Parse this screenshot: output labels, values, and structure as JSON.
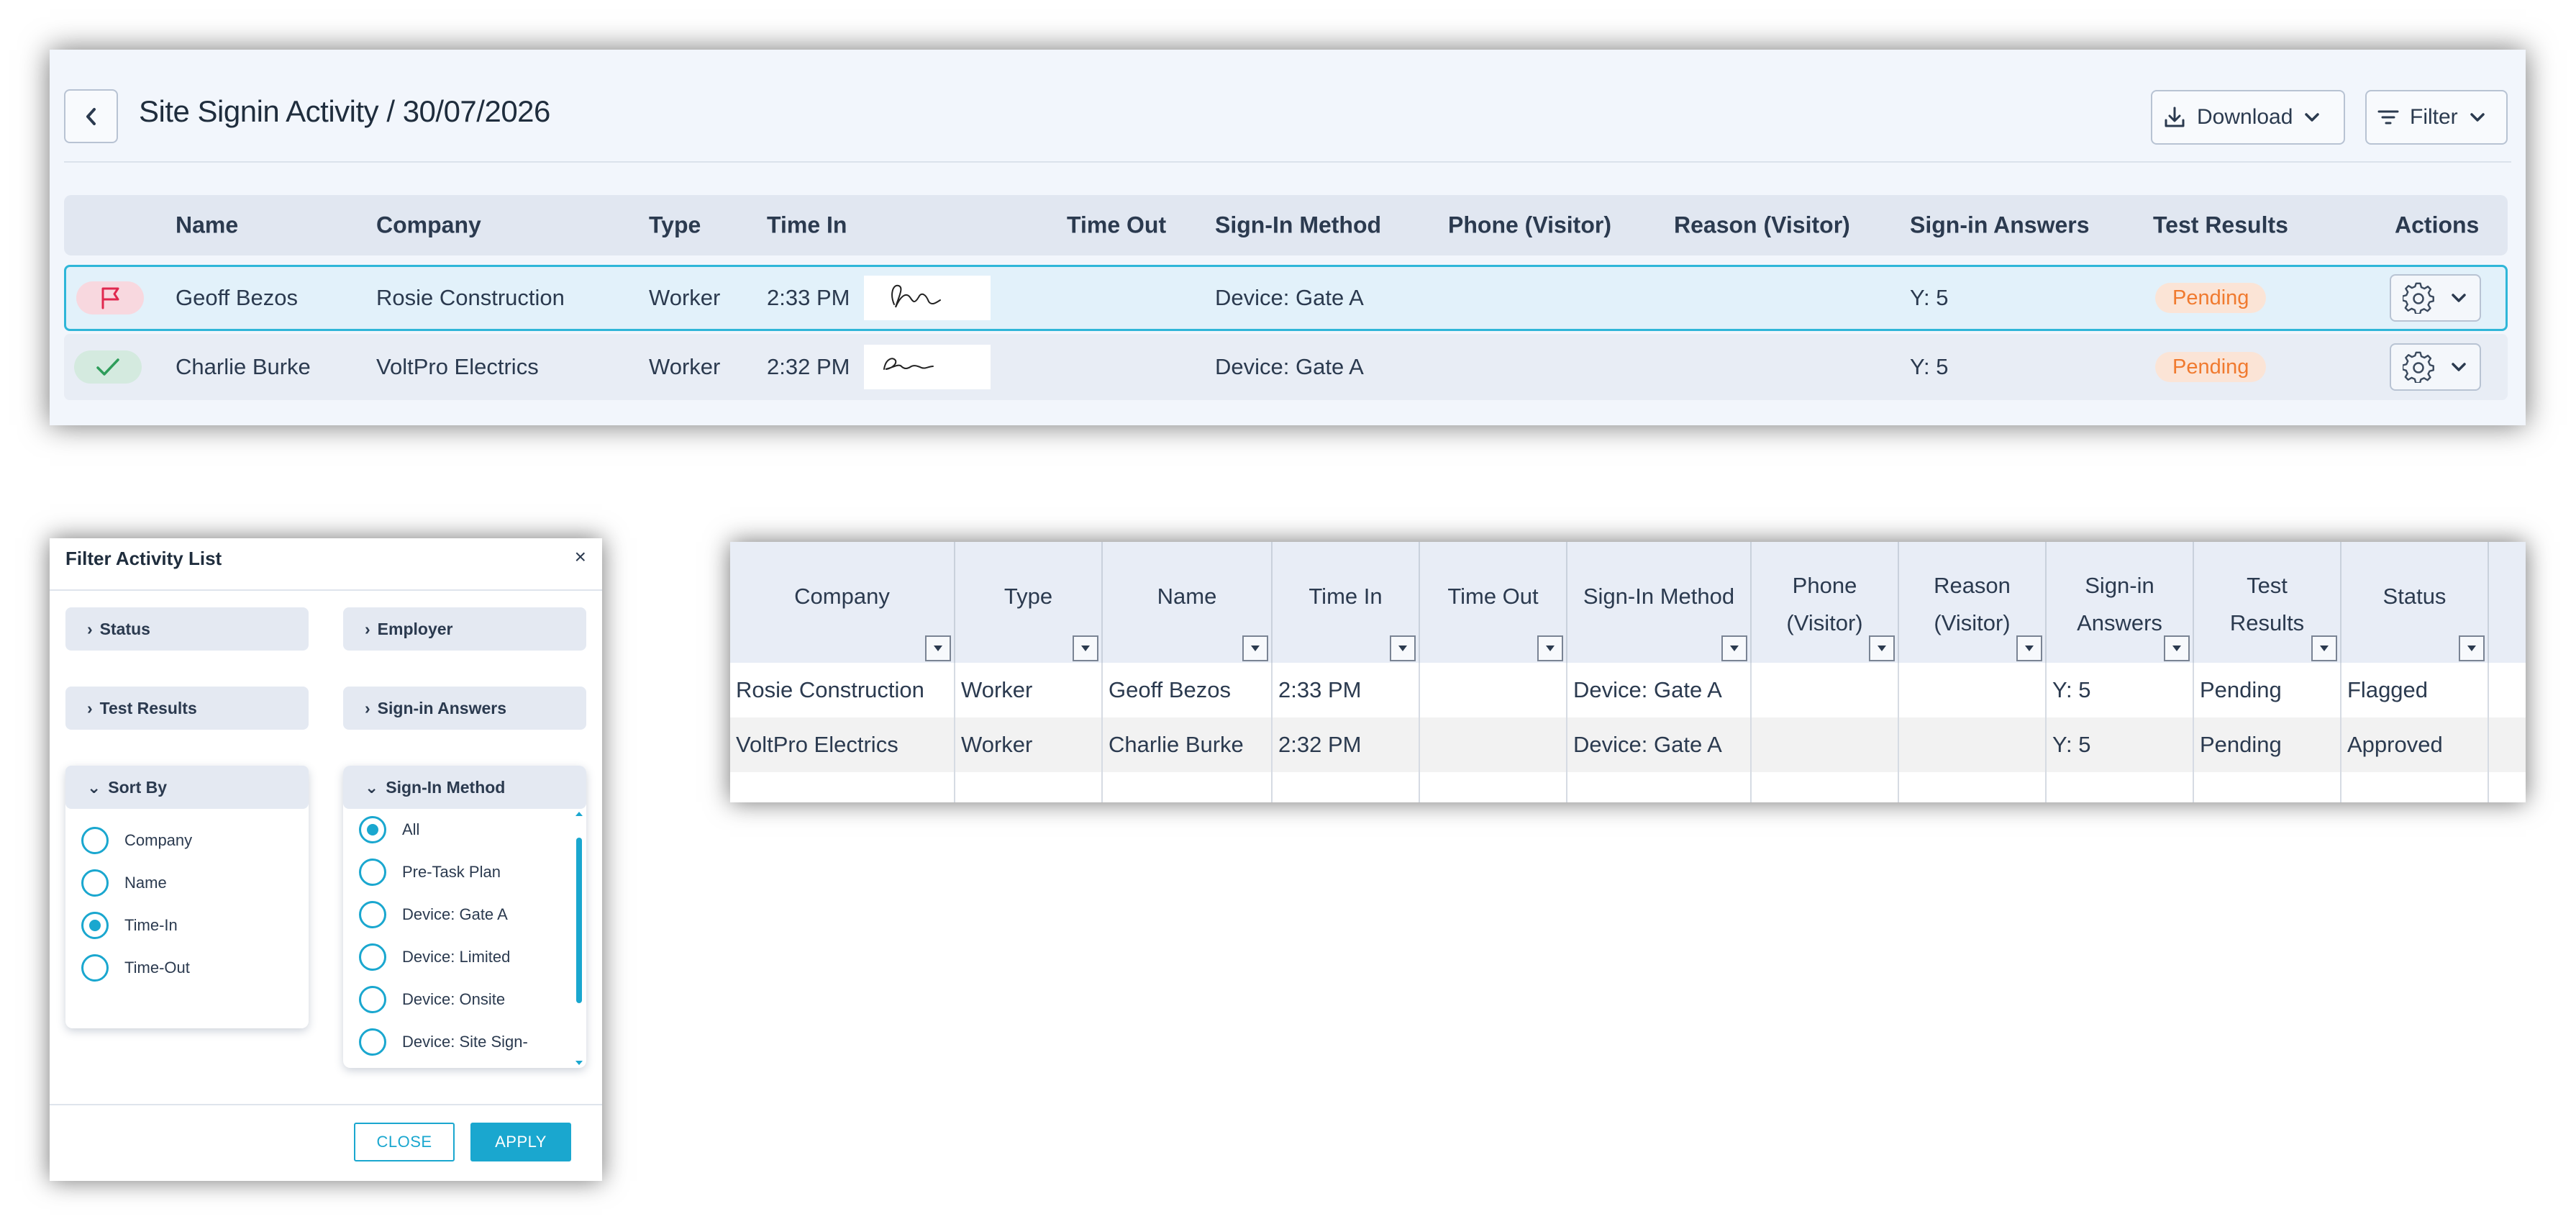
{
  "header": {
    "title": "Site Signin Activity",
    "separator": "/",
    "date": "30/07/2026",
    "download_label": "Download",
    "filter_label": "Filter"
  },
  "activity_table": {
    "columns": [
      "Name",
      "Company",
      "Type",
      "Time In",
      "Time Out",
      "Sign-In Method",
      "Phone (Visitor)",
      "Reason (Visitor)",
      "Sign-in Answers",
      "Test Results",
      "Actions"
    ],
    "rows": [
      {
        "status_icon": "flag-icon",
        "name": "Geoff Bezos",
        "company": "Rosie Construction",
        "type": "Worker",
        "time_in": "2:33 PM",
        "time_out": "",
        "method": "Device: Gate A",
        "answers": "Y: 5",
        "test_result": "Pending"
      },
      {
        "status_icon": "check-icon",
        "name": "Charlie Burke",
        "company": "VoltPro Electrics",
        "type": "Worker",
        "time_in": "2:32 PM",
        "time_out": "",
        "method": "Device: Gate A",
        "answers": "Y: 5",
        "test_result": "Pending"
      }
    ]
  },
  "filter_dialog": {
    "title": "Filter Activity List",
    "close_glyph": "×",
    "sections": {
      "status": "Status",
      "employer": "Employer",
      "test_results": "Test Results",
      "signin_answers": "Sign-in Answers",
      "sort_by": "Sort By",
      "signin_method": "Sign-In Method"
    },
    "sort_options": [
      "Company",
      "Name",
      "Time-In",
      "Time-Out"
    ],
    "sort_selected": "Time-In",
    "method_options": [
      "All",
      "Pre-Task Plan",
      "Device: Gate A",
      "Device: Limited",
      "Device: Onsite",
      "Device: Site Sign-"
    ],
    "method_selected": "All",
    "close_button": "CLOSE",
    "apply_button": "APPLY"
  },
  "sheet": {
    "columns": [
      "Company",
      "Type",
      "Name",
      "Time In",
      "Time Out",
      "Sign-In Method",
      "Phone (Visitor)",
      "Reason (Visitor)",
      "Sign-in Answers",
      "Test Results",
      "Status"
    ],
    "rows": [
      [
        "Rosie Construction",
        "Worker",
        "Geoff Bezos",
        "2:33 PM",
        "",
        "Device: Gate A",
        "",
        "",
        "Y: 5",
        "Pending",
        "Flagged"
      ],
      [
        "VoltPro Electrics",
        "Worker",
        "Charlie Burke",
        "2:32 PM",
        "",
        "Device: Gate A",
        "",
        "",
        "Y: 5",
        "Pending",
        "Approved"
      ]
    ]
  },
  "colors": {
    "accent": "#1aa7cf",
    "pending_text": "#f07a2f",
    "pending_bg": "#fbe4d6",
    "flag_red": "#e0294f",
    "check_green": "#2e9d5a"
  }
}
